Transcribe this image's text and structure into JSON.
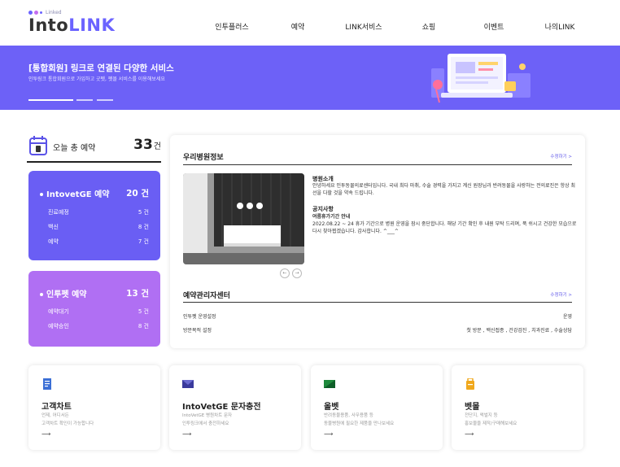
{
  "logo": {
    "small": "Linked",
    "into": "Into",
    "link": "LINK"
  },
  "nav": [
    "인투플러스",
    "예약",
    "LINK서비스",
    "쇼핑",
    "이벤트",
    "나의LINK"
  ],
  "banner": {
    "title": "[통합회원] 링크로 연결된 다양한 서비스",
    "subtitle": "인투링크 통합회원으로 가입하고 굿펫, 펫몰 서비스를 이용해보세요"
  },
  "today": {
    "label": "오늘 총 예약",
    "count": "33",
    "unit": "건"
  },
  "stats": [
    {
      "name": "IntovetGE 예약",
      "count": "20 건",
      "rows": [
        {
          "label": "진료예정",
          "value": "5 건"
        },
        {
          "label": "백신",
          "value": "8 건"
        },
        {
          "label": "예약",
          "value": "7 건"
        }
      ]
    },
    {
      "name": "인투펫 예약",
      "count": "13 건",
      "rows": [
        {
          "label": "예약대기",
          "value": "5 건"
        },
        {
          "label": "예약승인",
          "value": "8 건"
        }
      ]
    }
  ],
  "hospital": {
    "title": "우리병원정보",
    "edit": "수정하기 >",
    "intro_title": "병원소개",
    "intro_text": "안녕하세요 인투동물의료센터입니다. 국내 최다 마취, 수술 경력을 가지고 계신 원장님과 반려동물을 사랑하는 전의료진은 항상 최선을 다할 것을 약속 드립니다.",
    "notice_title": "공지사항",
    "notice_sub": "여름휴가기간 안내",
    "notice_text": "2022.08.22 ~ 24 휴가 기간으로 병원 운영을 잠시 중단합니다. 해당 기간 확인 후 내원 부탁 드리며, 푹 쉬시고 건강한 모습으로 다시 찾아뵙겠습니다. 감사합니다. ^___^",
    "prev": "←",
    "next": "→"
  },
  "management": {
    "title": "예약관리자센터",
    "edit": "수정하기 >",
    "rows": [
      {
        "label": "인투펫 운영설정",
        "value": "운영"
      },
      {
        "label": "방문목적 설정",
        "value": "첫 방문 , 백신접종 , 건강검진 , 치과진료 , 수술상담"
      }
    ]
  },
  "cards": [
    {
      "title": "고객차트",
      "desc": "언제, 어디서든\n고객차트 확인이 가능합니다",
      "arrow": "⟶",
      "icon": "document-icon",
      "color": "#3b6fd6"
    },
    {
      "title": "IntoVetGE 문자충전",
      "desc": "IntoVetGE 병원차트 문자\n인투링크에서 충전하세요",
      "arrow": "⟶",
      "icon": "envelope-icon",
      "color": "#3a3a9c"
    },
    {
      "title": "올벳",
      "desc": "반려동물용품, 사무용품 등\n동물병원에 필요한 제품을 만나보세요",
      "arrow": "⟶",
      "icon": "flag-icon",
      "color": "#1e8a3c"
    },
    {
      "title": "벳몰",
      "desc": "전단지, 액벌지 등\n홍보물을 제작/구매해보세요",
      "arrow": "⟶",
      "icon": "bag-icon",
      "color": "#f0a81c"
    }
  ]
}
